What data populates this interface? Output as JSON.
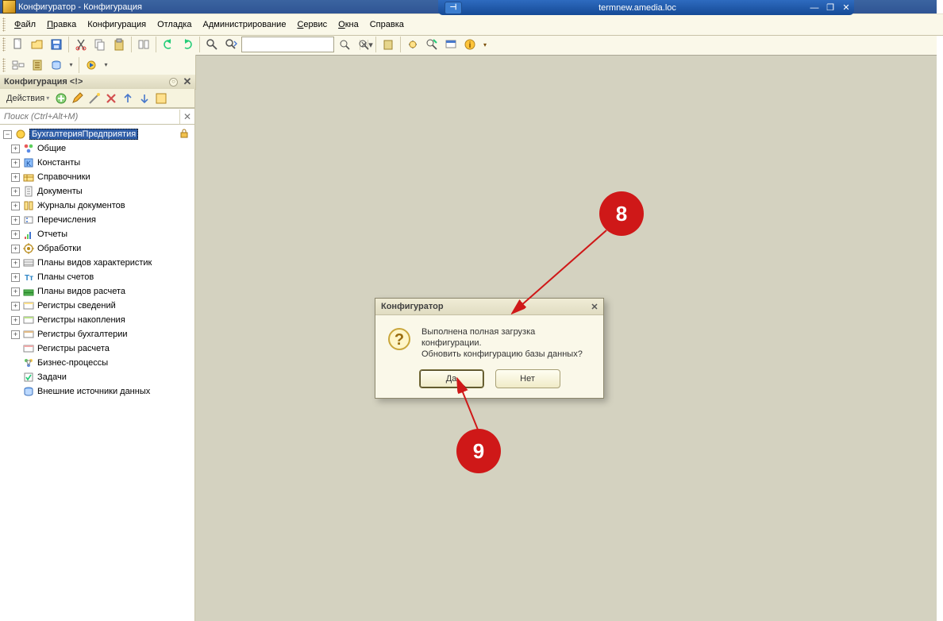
{
  "title_bar": {
    "app_title": "Конфигуратор - Конфигурация",
    "remote_host": "termnew.amedia.loc"
  },
  "menu": {
    "file": "Файл",
    "edit": "Правка",
    "config": "Конфигурация",
    "debug": "Отладка",
    "admin": "Администрирование",
    "service": "Сервис",
    "windows": "Окна",
    "help": "Справка"
  },
  "panel": {
    "title": "Конфигурация <!>"
  },
  "tree_toolbar": {
    "actions_label": "Действия"
  },
  "tree_search": {
    "placeholder": "Поиск (Ctrl+Alt+M)"
  },
  "tree": {
    "root": "БухгалтерияПредприятия",
    "items": [
      "Общие",
      "Константы",
      "Справочники",
      "Документы",
      "Журналы документов",
      "Перечисления",
      "Отчеты",
      "Обработки",
      "Планы видов характеристик",
      "Планы счетов",
      "Планы видов расчета",
      "Регистры сведений",
      "Регистры накопления",
      "Регистры бухгалтерии",
      "Регистры расчета",
      "Бизнес-процессы",
      "Задачи",
      "Внешние источники данных"
    ]
  },
  "dialog": {
    "title": "Конфигуратор",
    "line1": "Выполнена полная загрузка конфигурации.",
    "line2": "Обновить конфигурацию базы данных?",
    "btn_yes": "Да",
    "btn_no": "Нет"
  },
  "callouts": {
    "c8": "8",
    "c9": "9"
  }
}
